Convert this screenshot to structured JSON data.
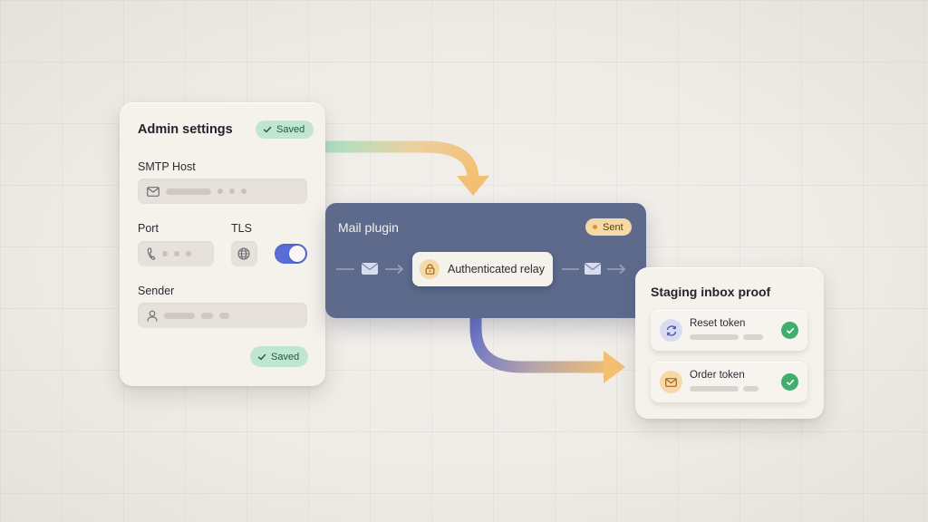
{
  "admin_settings": {
    "title": "Admin settings",
    "saved_badge": "Saved",
    "smtp_host_label": "SMTP Host",
    "port_label": "Port",
    "tls_label": "TLS",
    "tls_enabled": true,
    "sender_label": "Sender",
    "saved_button": "Saved",
    "icons": [
      "check-icon",
      "envelope-icon",
      "phone-icon",
      "globe-icon",
      "user-icon"
    ]
  },
  "mail_plugin": {
    "title": "Mail plugin",
    "status": "Sent",
    "relay_label": "Authenticated relay",
    "icons": [
      "envelope-icon",
      "lock-icon",
      "arrow-right-icon"
    ]
  },
  "staging_inbox": {
    "title": "Staging inbox proof",
    "tokens": [
      {
        "name": "Reset token",
        "icon": "refresh-icon",
        "status": "verified"
      },
      {
        "name": "Order token",
        "icon": "envelope-icon",
        "status": "verified"
      }
    ]
  },
  "colors": {
    "background": "#efebe6",
    "plugin": "#5d6a8c",
    "toggle_on": "#5a6cd9",
    "saved_green": "#bfe6d3",
    "sent_amber": "#f5d9a6",
    "check_green": "#3fae6e",
    "arrow_orange": "#f2c27a"
  }
}
